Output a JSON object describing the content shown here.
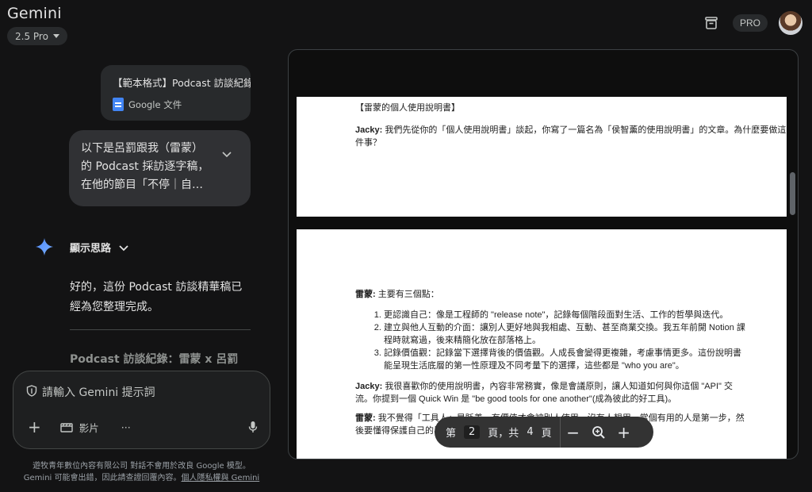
{
  "app": {
    "title": "Gemini",
    "model": "2.5 Pro",
    "pro_badge": "PRO"
  },
  "conversation": {
    "attachment": {
      "name": "【範本格式】Podcast 訪談紀錄",
      "type": "Google 文件"
    },
    "user_message": "以下是呂罰跟我（雷蒙）的 Podcast 採訪逐字稿，在他的節目「不停｜自…",
    "thinking_label": "顯示思路",
    "reply_text": "好的，這份 Podcast 訪談精華稿已經為您整理完成。",
    "reply_heading": "Podcast 訪談紀錄：雷蒙 x 呂罰"
  },
  "prompt": {
    "placeholder": "請輸入 Gemini 提示詞",
    "video_label": "影片",
    "more_label": "···"
  },
  "disclaimer": {
    "line1": "遊牧青年數位內容有限公司 對話不會用於改良 Google 模型。",
    "line2": "Gemini 可能會出錯，因此請查證回覆內容。",
    "link": "個人隱私權與 Gemini"
  },
  "document": {
    "page1": {
      "title": "【雷蒙的個人使用說明書】",
      "speaker": "Jacky:",
      "text": " 我們先從你的「個人使用說明書」談起，你寫了一篇名為「侯智薰的使用說明書」的文章。為什麼要做這件事？"
    },
    "page2": {
      "intro_speaker": "雷蒙:",
      "intro_text": " 主要有三個點：",
      "items": [
        "更認識自己：像是工程師的 \"release note\"，記錄每個階段面對生活、工作的哲學與迭代。",
        "建立與他人互動的介面：讓別人更好地與我相處、互動、甚至商業交換。我五年前開 Notion 課程時就寫過，後來精簡化放在部落格上。",
        "記錄價值觀：記錄當下選擇背後的價值觀。人成長會變得更複雜，考慮事情更多。這份說明書能呈現生活底層的第一性原理及不同考量下的選擇，這些都是 \"who you are\"。"
      ],
      "q_speaker": "Jacky:",
      "q_text": " 我很喜歡你的使用說明書，內容非常務實，像是會議原則，讓人知道如何與你這個 \"API\" 交流。你提到一個 Quick Win 是 \"be good tools for one another\"(成為彼此的好工具)。",
      "a_speaker": "雷蒙:",
      "a_text": " 我不覺得「工具人」是貶義，有價值才會被別人使用，沒有人想用。當個有用的人是第一步，然後要懂得保護自己的界線。"
    },
    "pager": {
      "prefix": "第",
      "current": "2",
      "middle": "頁，共",
      "total": "4",
      "suffix": "頁"
    }
  }
}
